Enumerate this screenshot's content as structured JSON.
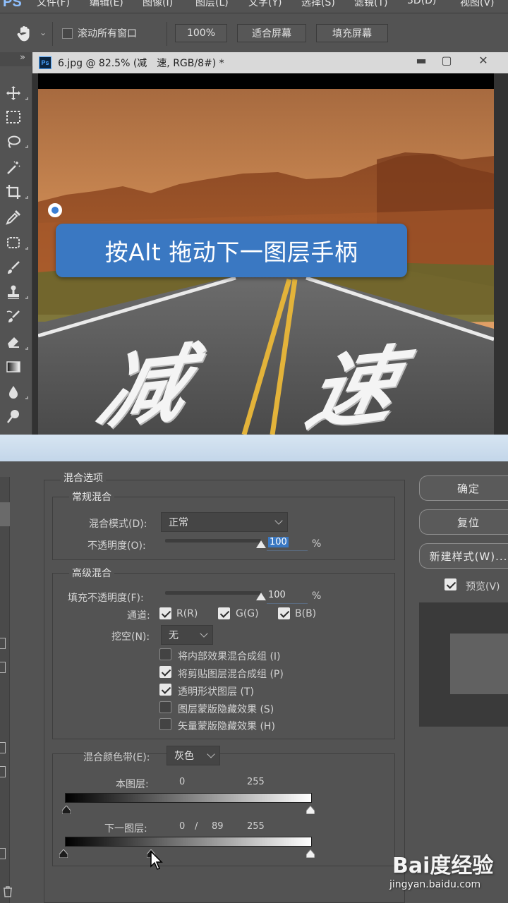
{
  "app": {
    "logo": "PS"
  },
  "menu": [
    "文件(F)",
    "编辑(E)",
    "图像(I)",
    "图层(L)",
    "文字(Y)",
    "选择(S)",
    "滤镜(T)",
    "3D(D)",
    "视图(V)"
  ],
  "options": {
    "scroll_all_label": "滚动所有窗口",
    "zoom_value": "100%",
    "fit_screen": "适合屏幕",
    "fill_screen": "填充屏幕"
  },
  "toolbar": {
    "close": "»"
  },
  "document": {
    "tab_icon": "Ps",
    "title": "6.jpg @ 82.5% (减　速, RGB/8#) *",
    "minimize": "▬",
    "maximize": "▢",
    "close": "✕",
    "tip": "按Alt 拖动下一图层手柄",
    "road_text_1": "减",
    "road_text_2": "速"
  },
  "dialog": {
    "blend_options": "混合选项",
    "general_blend": {
      "title": "常规混合",
      "mode_label": "混合模式(D):",
      "mode_value": "正常",
      "opacity_label": "不透明度(O):",
      "opacity_value": "100",
      "opacity_fraction": 1.0,
      "percent": "%"
    },
    "advanced_blend": {
      "title": "高级混合",
      "fill_label": "填充不透明度(F):",
      "fill_value": "100",
      "fill_fraction": 1.0,
      "percent": "%",
      "channels_label": "通道:",
      "channels": [
        {
          "label": "R(R)",
          "checked": true
        },
        {
          "label": "G(G)",
          "checked": true
        },
        {
          "label": "B(B)",
          "checked": true
        }
      ],
      "knockout_label": "挖空(N):",
      "knockout_value": "无",
      "options": [
        {
          "label": "将内部效果混合成组 (I)",
          "checked": false
        },
        {
          "label": "将剪贴图层混合成组 (P)",
          "checked": true
        },
        {
          "label": "透明形状图层 (T)",
          "checked": true
        },
        {
          "label": "图层蒙版隐藏效果 (S)",
          "checked": false
        },
        {
          "label": "矢量蒙版隐藏效果 (H)",
          "checked": false
        }
      ]
    },
    "blend_if": {
      "label": "混合颜色带(E):",
      "value": "灰色",
      "this_layer": {
        "label": "本图层:",
        "low": "0",
        "high": "255"
      },
      "underlying_layer": {
        "label": "下一图层:",
        "low": "0",
        "slash": "/",
        "split": "89",
        "high": "255",
        "split_fraction": 0.349
      }
    },
    "buttons": {
      "ok": "确定",
      "reset": "复位",
      "new_style": "新建样式(W)...",
      "preview_label": "预览(V)"
    }
  },
  "watermark": {
    "brand": "Bai度经验",
    "url": "jingyan.baidu.com"
  },
  "colors": {
    "accent": "#3a78c2",
    "ui_gray": "#535353",
    "dark": "#2b2b2b"
  }
}
